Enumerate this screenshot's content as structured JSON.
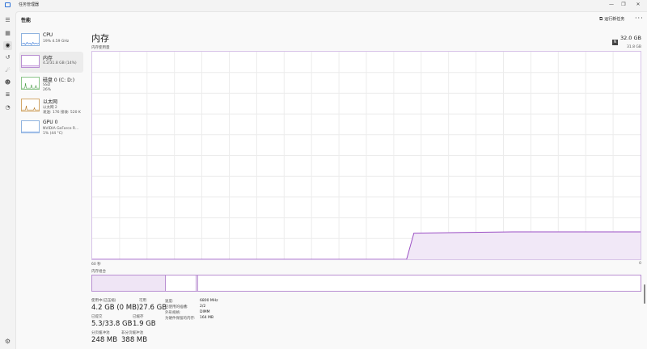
{
  "window": {
    "title": "任务管理器",
    "controls": {
      "minimize": "—",
      "maximize": "❐",
      "close": "✕"
    }
  },
  "nav": {
    "items": [
      {
        "icon": "☰"
      },
      {
        "icon": "▦"
      },
      {
        "icon": "◉"
      },
      {
        "icon": "↺"
      },
      {
        "icon": "☄"
      },
      {
        "icon": "☻"
      },
      {
        "icon": "≣"
      },
      {
        "icon": "◔"
      }
    ],
    "settings_icon": "⚙"
  },
  "header": {
    "section_title": "性能",
    "run_task_icon": "⧉",
    "run_task_label": "运行新任务",
    "more_label": "···"
  },
  "perf_list": [
    {
      "name": "CPU",
      "sub1": "19% 4.59 GHz",
      "sub2": ""
    },
    {
      "name": "内存",
      "sub1": "4.2/31.8 GB (14%)",
      "sub2": ""
    },
    {
      "name": "磁盘 0 (C: D:)",
      "sub1": "SSD",
      "sub2": "26%"
    },
    {
      "name": "以太网",
      "sub1": "以太网 2",
      "sub2": "发送: 176 接收: 520 K"
    },
    {
      "name": "GPU 0",
      "sub1": "NVIDIA GeForce R...",
      "sub2": "1% (44 °C)"
    }
  ],
  "detail": {
    "title": "内存",
    "total_capacity": "32.0 GB",
    "usage_label": "内存使用量",
    "usage_max": "31.8 GB",
    "badge": "N",
    "axis_left": "60 秒",
    "axis_right": "0",
    "composition_label": "内存组合",
    "stats": {
      "in_use_label": "使用中(已压缩)",
      "in_use_value": "4.2 GB (0 MB)",
      "available_label": "可用",
      "available_value": "27.6 GB",
      "committed_label": "已提交",
      "committed_value": "5.3/33.8 GB",
      "cached_label": "已缓存",
      "cached_value": "1.9 GB",
      "paged_label": "分页缓冲池",
      "paged_value": "248 MB",
      "nonpaged_label": "非分页缓冲池",
      "nonpaged_value": "388 MB"
    },
    "specs": [
      {
        "key": "速度:",
        "value": "6800 MHz"
      },
      {
        "key": "已使用的插槽:",
        "value": "2/2"
      },
      {
        "key": "外形规格:",
        "value": "DIMM"
      },
      {
        "key": "为硬件保留的内存:",
        "value": "164 MB"
      }
    ]
  },
  "usage_history": {
    "max_gb": 31.8,
    "points": [
      [
        60,
        0
      ],
      [
        25.6,
        0
      ],
      [
        24.8,
        4.0
      ],
      [
        20,
        4.1
      ],
      [
        14,
        4.2
      ],
      [
        0,
        4.2
      ]
    ]
  },
  "colors": {
    "memory_line": "#9b4fc4",
    "memory_fill": "#f1e8f7",
    "grid": "#ececec"
  }
}
